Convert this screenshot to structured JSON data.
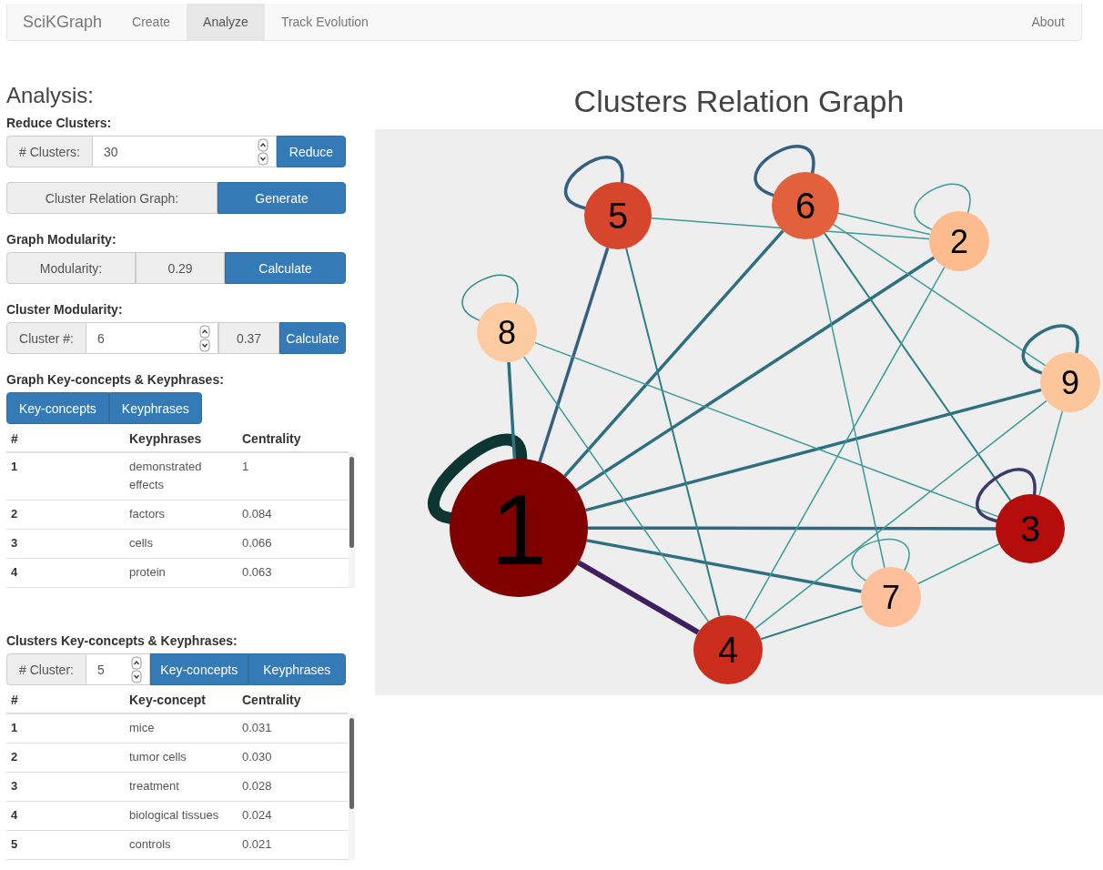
{
  "navbar": {
    "brand": "SciKGraph",
    "items": [
      {
        "label": "Create",
        "selected": false
      },
      {
        "label": "Analyze",
        "selected": true
      },
      {
        "label": "Track Evolution",
        "selected": false
      }
    ],
    "about": "About"
  },
  "analysis": {
    "title": "Analysis:",
    "reduce": {
      "heading": "Reduce Clusters:",
      "addon": "# Clusters:",
      "value": "30",
      "button": "Reduce"
    },
    "relation": {
      "label": "Cluster Relation Graph:",
      "button": "Generate"
    },
    "graph_modularity": {
      "heading": "Graph Modularity:",
      "addon": "Modularity:",
      "value": "0.29",
      "button": "Calculate"
    },
    "cluster_modularity": {
      "heading": "Cluster Modularity:",
      "addon": "Cluster #:",
      "value": "6",
      "result": "0.37",
      "button": "Calculate"
    },
    "graph_key": {
      "heading": "Graph Key-concepts & Keyphrases:",
      "buttons": [
        "Key-concepts",
        "Keyphrases"
      ],
      "table": {
        "columns": [
          "#",
          "Keyphrases",
          "Centrality"
        ],
        "rows": [
          [
            "1",
            "demonstrated effects",
            "1"
          ],
          [
            "2",
            "factors",
            "0.084"
          ],
          [
            "3",
            "cells",
            "0.066"
          ],
          [
            "4",
            "protein",
            "0.063"
          ]
        ]
      }
    },
    "clusters_key": {
      "heading": "Clusters Key-concepts & Keyphrases:",
      "addon": "# Cluster:",
      "value": "5",
      "buttons": [
        "Key-concepts",
        "Keyphrases"
      ],
      "table": {
        "columns": [
          "#",
          "Key-concept",
          "Centrality"
        ],
        "rows": [
          [
            "1",
            "mice",
            "0.031"
          ],
          [
            "2",
            "tumor cells",
            "0.030"
          ],
          [
            "3",
            "treatment",
            "0.028"
          ],
          [
            "4",
            "biological tissues",
            "0.024"
          ],
          [
            "5",
            "controls",
            "0.021"
          ]
        ]
      }
    }
  },
  "graph": {
    "title": "Clusters Relation Graph",
    "nodes": [
      {
        "label": "1",
        "color": "#800000"
      },
      {
        "label": "2",
        "color": "#fdbb8e"
      },
      {
        "label": "3",
        "color": "#b50c0c"
      },
      {
        "label": "4",
        "color": "#cc2e1e"
      },
      {
        "label": "5",
        "color": "#d5462d"
      },
      {
        "label": "6",
        "color": "#e2603c"
      },
      {
        "label": "7",
        "color": "#fdc09a"
      },
      {
        "label": "8",
        "color": "#fdcba2"
      },
      {
        "label": "9",
        "color": "#fdc59a"
      }
    ]
  }
}
